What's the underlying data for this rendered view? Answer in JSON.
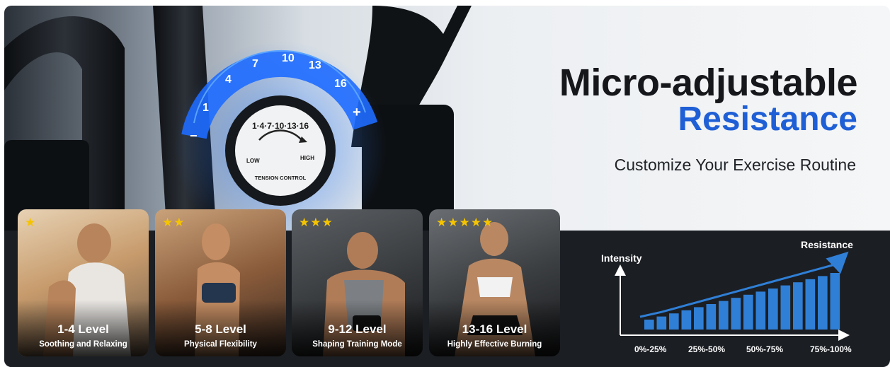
{
  "headline": {
    "line1": "Micro-adjustable",
    "line2": "Resistance",
    "subtitle": "Customize Your Exercise Routine"
  },
  "dial": {
    "scale_labels": [
      "−",
      "1",
      "4",
      "7",
      "10",
      "13",
      "16",
      "+"
    ],
    "knob_scale": "1·4·7·10·13·16",
    "low": "LOW",
    "high": "HIGH",
    "caption": "TENSION CONTROL"
  },
  "cards": [
    {
      "stars": "★",
      "level": "1-4 Level",
      "desc": "Soothing and Relaxing"
    },
    {
      "stars": "★★",
      "level": "5-8 Level",
      "desc": "Physical Flexibility"
    },
    {
      "stars": "★★★",
      "level": "9-12 Level",
      "desc": "Shaping Training Mode"
    },
    {
      "stars": "★★★★★",
      "level": "13-16 Level",
      "desc": "Highly Effective Burning"
    }
  ],
  "chart_data": {
    "type": "bar",
    "ylabel": "Intensity",
    "trend_label": "Resistance",
    "tick_labels": [
      "0%-25%",
      "25%-50%",
      "50%-75%",
      "75%-100%"
    ],
    "values": [
      1,
      2,
      3,
      4,
      5,
      6,
      7,
      8,
      9,
      10,
      11,
      12,
      13,
      14,
      15,
      16
    ],
    "bar_color": "#2f7fd6",
    "arrow_color": "#2f7fd6",
    "grid": false
  },
  "colors": {
    "accent": "#1f5fd6",
    "dark_panel": "#1b1e23",
    "star": "#f5c400"
  }
}
